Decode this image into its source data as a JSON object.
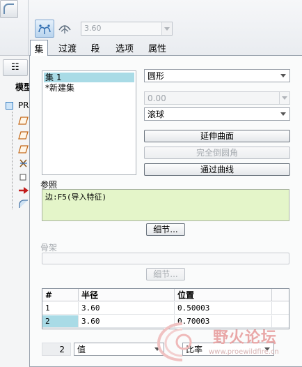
{
  "toolbar": {
    "radius_value": "3.60"
  },
  "tabs": [
    {
      "label": "集",
      "active": true
    },
    {
      "label": "过渡"
    },
    {
      "label": "段"
    },
    {
      "label": "选项"
    },
    {
      "label": "属性"
    }
  ],
  "model_tree": {
    "title": "模型",
    "root_label": "PR",
    "icons": [
      "plane-feature-icon",
      "plane-feature-icon",
      "plane-feature-icon",
      "csys-icon",
      "point-icon",
      "insert-arrow-icon",
      "round-feature-icon"
    ]
  },
  "sets": {
    "items": [
      "集 1",
      "*新建集"
    ],
    "selected_index": 0
  },
  "shape": {
    "value": "圆形"
  },
  "radius_field": {
    "value": "0.00"
  },
  "ball": {
    "value": "滚球"
  },
  "buttons": {
    "extend_surface": "延伸曲面",
    "full_round": "完全倒圆角",
    "through_curve": "通过曲线",
    "detail": "细节..."
  },
  "references": {
    "label": "参照",
    "content": "边:F5(导入特征)"
  },
  "skeleton": {
    "label": "骨架"
  },
  "radius_table": {
    "headers": [
      "#",
      "半径",
      "位置"
    ],
    "rows": [
      {
        "num": "1",
        "radius": "3.60",
        "position": "0.50003"
      },
      {
        "num": "2",
        "radius": "3.60",
        "position": "0.70003"
      }
    ],
    "selected_row": 2
  },
  "bottom": {
    "count": "2",
    "mode": "值",
    "ratio": "比率"
  },
  "watermark": {
    "text": "野火论坛",
    "url": "www.proewildfire.cn"
  },
  "colors": {
    "selection": "#a9dbe6",
    "reference_bg": "#e4f5c9"
  }
}
